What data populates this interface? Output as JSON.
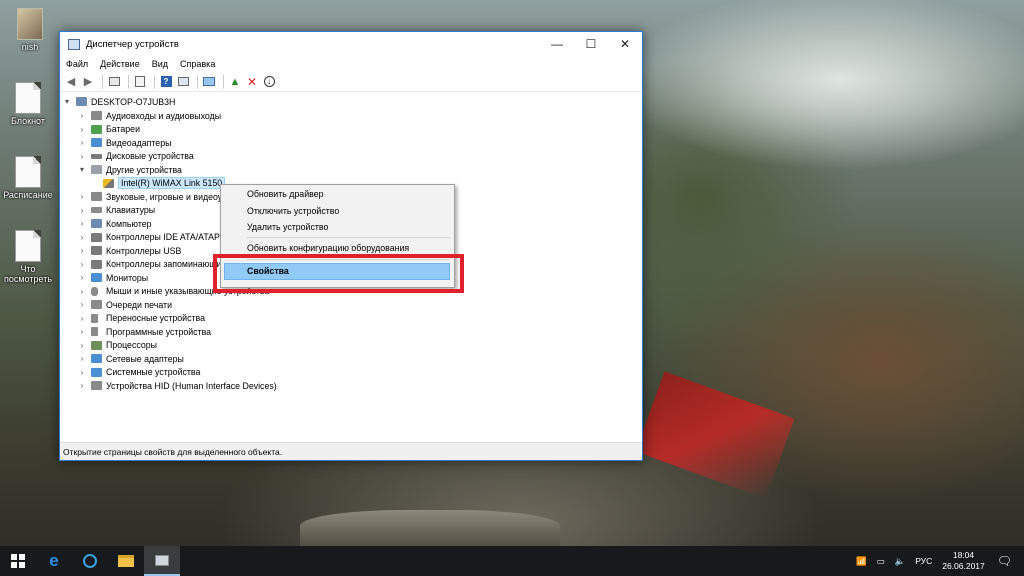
{
  "desktop": {
    "icons": [
      {
        "label": "nish"
      },
      {
        "label": "Блокнот"
      },
      {
        "label": "Расписание"
      },
      {
        "label": "Что посмотреть"
      }
    ]
  },
  "window": {
    "title": "Диспетчер устройств",
    "controls": {
      "minimize": "—",
      "maximize": "☐",
      "close": "✕"
    },
    "menu": [
      "Файл",
      "Действие",
      "Вид",
      "Справка"
    ],
    "root": "DESKTOP-O7JUB3H",
    "categories": [
      "Аудиовходы и аудиовыходы",
      "Батареи",
      "Видеоадаптеры",
      "Дисковые устройства",
      "Другие устройства",
      "Intel(R) WiMAX Link 5150",
      "Звуковые, игровые и видеоустройства",
      "Клавиатуры",
      "Компьютер",
      "Контроллеры IDE ATA/ATAPI",
      "Контроллеры USB",
      "Контроллеры запоминающих устройств",
      "Мониторы",
      "Мыши и иные указывающие устройства",
      "Очереди печати",
      "Переносные устройства",
      "Программные устройства",
      "Процессоры",
      "Сетевые адаптеры",
      "Системные устройства",
      "Устройства HID (Human Interface Devices)"
    ],
    "status": "Открытие страницы свойств для выделенного объекта."
  },
  "context_menu": {
    "items": [
      "Обновить драйвер",
      "Отключить устройство",
      "Удалить устройство",
      "Обновить конфигурацию оборудования",
      "Свойства"
    ]
  },
  "taskbar": {
    "start_icon": "windows-logo-icon",
    "apps": [
      "edge-icon",
      "media-icon",
      "file-explorer-icon",
      "device-manager-icon"
    ],
    "tray": {
      "language": "РУС",
      "time": "18:04",
      "date": "26.06.2017"
    }
  },
  "colors": {
    "selection": "#91c9f7",
    "highlight_box": "#e0202a",
    "window_border": "#2b79d0",
    "taskbar": "#171a1c"
  }
}
